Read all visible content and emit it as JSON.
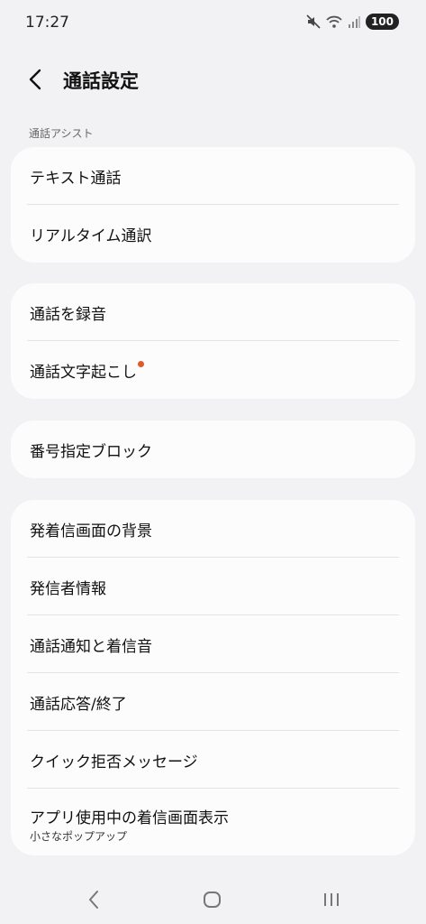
{
  "status_bar": {
    "time": "17:27",
    "battery": "100",
    "icons": [
      "mute-icon",
      "wifi-icon",
      "signal-icon"
    ]
  },
  "header": {
    "title": "通話設定",
    "back_icon": "back-arrow-icon"
  },
  "section_label": "通話アシスト",
  "cards": [
    {
      "rows": [
        {
          "label": "テキスト通話"
        },
        {
          "label": "リアルタイム通訳"
        }
      ]
    },
    {
      "rows": [
        {
          "label": "通話を録音"
        },
        {
          "label": "通話文字起こし",
          "badge": "new-dot"
        }
      ]
    },
    {
      "rows": [
        {
          "label": "番号指定ブロック"
        }
      ]
    },
    {
      "rows": [
        {
          "label": "発着信画面の背景"
        },
        {
          "label": "発信者情報"
        },
        {
          "label": "通話通知と着信音"
        },
        {
          "label": "通話応答/終了"
        },
        {
          "label": "クイック拒否メッセージ"
        },
        {
          "label": "アプリ使用中の着信画面表示",
          "sub": "小さなポップアップ"
        }
      ]
    }
  ],
  "nav_bar": {
    "icons": [
      "nav-back-icon",
      "nav-home-icon",
      "nav-recents-icon"
    ]
  },
  "colors": {
    "background": "#f2f2f4",
    "card": "#fcfcfc",
    "badge_dot": "#e05a2b"
  }
}
